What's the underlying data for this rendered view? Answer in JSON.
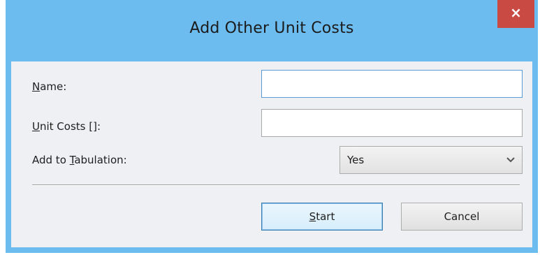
{
  "window": {
    "title": "Add Other Unit Costs",
    "close_label": "×"
  },
  "form": {
    "name_label_prefix": "",
    "name_label_accel": "N",
    "name_label_rest": "ame:",
    "name_value": "",
    "unit_costs_label_prefix": "",
    "unit_costs_label_accel": "U",
    "unit_costs_label_rest": "nit Costs []:",
    "unit_costs_value": "",
    "tabulation_label_prefix": "Add to ",
    "tabulation_label_accel": "T",
    "tabulation_label_rest": "abulation:",
    "tabulation_selected": "Yes"
  },
  "buttons": {
    "start_accel": "S",
    "start_rest": "tart",
    "cancel_label": "Cancel"
  },
  "colors": {
    "titlebar": "#6cbcf0",
    "close_button": "#c94a43",
    "client_background": "#eef0f4"
  },
  "icons": {
    "close": "close-icon",
    "dropdown": "chevron-down-icon"
  }
}
